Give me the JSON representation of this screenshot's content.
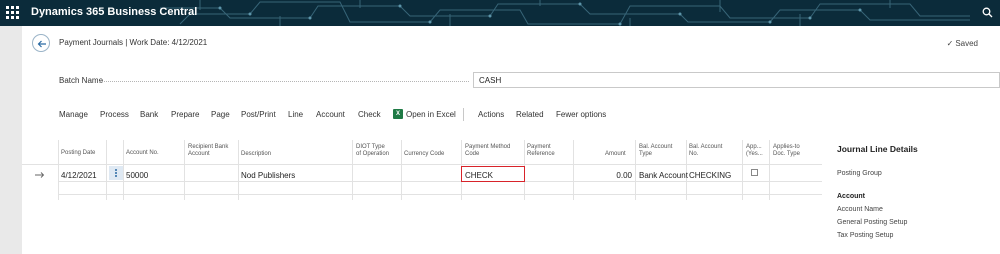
{
  "app": {
    "title": "Dynamics 365 Business Central"
  },
  "page": {
    "caption": "Payment Journals | Work Date: 4/12/2021",
    "saved": "Saved"
  },
  "batch": {
    "label": "Batch Name",
    "value": "CASH"
  },
  "actions": [
    "Manage",
    "Process",
    "Bank",
    "Prepare",
    "Page",
    "Post/Print",
    "Line",
    "Account",
    "Check",
    "Open in Excel",
    "Actions",
    "Related",
    "Fewer options"
  ],
  "columns": {
    "posting_date": "Posting Date",
    "account_no": "Account No.",
    "recipient_bank_1": "Recipient Bank",
    "recipient_bank_2": "Account",
    "description": "Description",
    "diot_1": "DIOT Type",
    "diot_2": "of Operation",
    "currency": "Currency Code",
    "pay_method_1": "Payment Method",
    "pay_method_2": "Code",
    "pay_ref_1": "Payment",
    "pay_ref_2": "Reference",
    "amount": "Amount",
    "bal_type_1": "Bal. Account",
    "bal_type_2": "Type",
    "bal_no_1": "Bal. Account",
    "bal_no_2": "No.",
    "applies_yes_1": "App...",
    "applies_yes_2": "(Yes...",
    "applies_doc_1": "Applies-to",
    "applies_doc_2": "Doc. Type"
  },
  "row": {
    "posting_date": "4/12/2021",
    "account_no": "50000",
    "description": "Nod Publishers",
    "payment_method": "CHECK",
    "amount": "0.00",
    "bal_account_type": "Bank Account",
    "bal_account_no": "CHECKING"
  },
  "details": {
    "title": "Journal Line Details",
    "posting_group": "Posting Group",
    "account": "Account",
    "account_name": "Account Name",
    "gen_posting": "General Posting Setup",
    "tax_posting": "Tax Posting Setup"
  },
  "colors": {
    "topbar": "#0b2b3a",
    "accent": "#2a6aa3",
    "focus": "#d8232a",
    "excel": "#1f7a45"
  },
  "icons": [
    "waffle-icon",
    "search-icon",
    "back-arrow-icon",
    "checkmark-icon",
    "excel-icon",
    "row-arrow-icon",
    "more-options-icon"
  ]
}
